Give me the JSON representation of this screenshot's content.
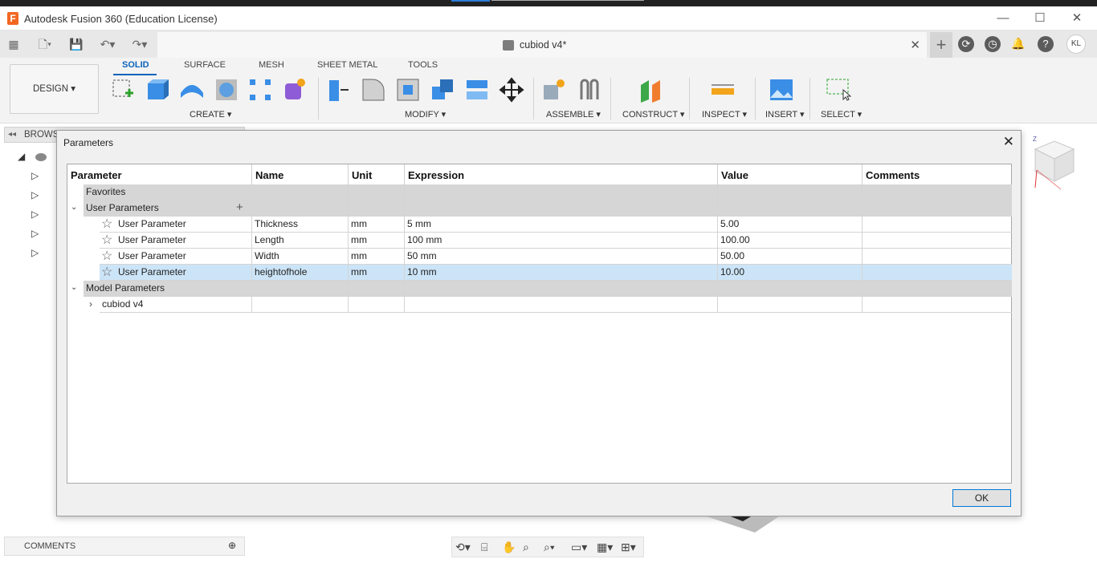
{
  "app": {
    "title": "Autodesk Fusion 360 (Education License)",
    "logo": "F"
  },
  "window_controls": {
    "minimize": "—",
    "maximize": "☐",
    "close": "✕"
  },
  "document": {
    "tab_label": "cubiod v4*",
    "close": "✕"
  },
  "user": {
    "initials": "KL"
  },
  "ribbon": {
    "design_label": "DESIGN ▾",
    "tabs": [
      "SOLID",
      "SURFACE",
      "MESH",
      "SHEET METAL",
      "TOOLS"
    ],
    "groups": [
      "CREATE ▾",
      "MODIFY ▾",
      "ASSEMBLE ▾",
      "CONSTRUCT ▾",
      "INSPECT ▾",
      "INSERT ▾",
      "SELECT ▾"
    ]
  },
  "browser": {
    "title": "BROWS"
  },
  "dialog": {
    "title": "Parameters",
    "close": "✕",
    "columns": [
      "Parameter",
      "Name",
      "Unit",
      "Expression",
      "Value",
      "Comments"
    ],
    "favorites_label": "Favorites",
    "user_params_label": "User Parameters",
    "model_params_label": "Model Parameters",
    "add_icon": "+",
    "user_params": [
      {
        "param": "User Parameter",
        "name": "Thickness",
        "unit": "mm",
        "expression": "5 mm",
        "value": "5.00",
        "comments": ""
      },
      {
        "param": "User Parameter",
        "name": "Length",
        "unit": "mm",
        "expression": "100 mm",
        "value": "100.00",
        "comments": ""
      },
      {
        "param": "User Parameter",
        "name": "Width",
        "unit": "mm",
        "expression": "50 mm",
        "value": "50.00",
        "comments": ""
      },
      {
        "param": "User Parameter",
        "name": "heightofhole",
        "unit": "mm",
        "expression": "10 mm",
        "value": "10.00",
        "comments": ""
      }
    ],
    "model_item": "cubiod v4",
    "ok_label": "OK"
  },
  "comments_panel": {
    "label": "COMMENTS"
  },
  "colors": {
    "accent": "#0b63b9",
    "selected_row": "#cce4f7",
    "group_row": "#d6d6d6"
  }
}
